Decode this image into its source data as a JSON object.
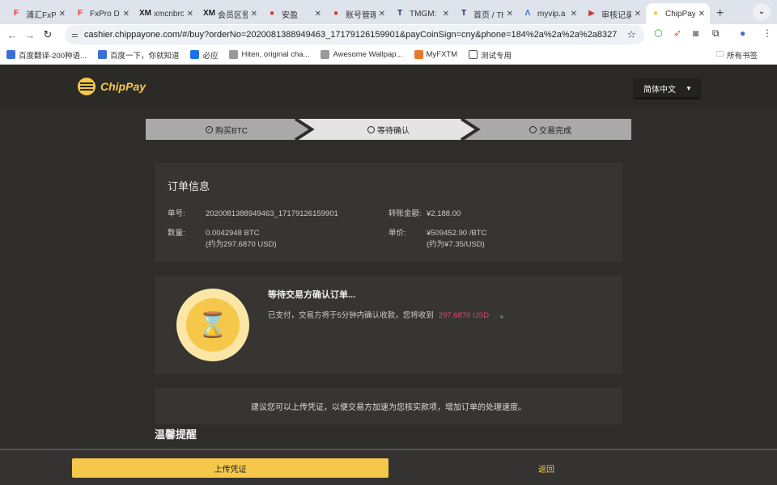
{
  "browser": {
    "tabs": [
      {
        "label": "浦汇FxPr",
        "fav": "F",
        "color": "#e03a3a"
      },
      {
        "label": "FxPro Di",
        "fav": "F",
        "color": "#e03a3a"
      },
      {
        "label": "xmcnbro",
        "fav": "XM",
        "color": "#222"
      },
      {
        "label": "会员区登",
        "fav": "XM",
        "color": "#222"
      },
      {
        "label": "安盈",
        "fav": "●",
        "color": "#d33"
      },
      {
        "label": "账号管理",
        "fav": "●",
        "color": "#d33"
      },
      {
        "label": "TMGM: I",
        "fav": "T",
        "color": "#1a2a5a"
      },
      {
        "label": "首页 / Th",
        "fav": "T",
        "color": "#1a2a5a"
      },
      {
        "label": "myvip.a",
        "fav": "Λ",
        "color": "#3a6fd8"
      },
      {
        "label": "审核记录",
        "fav": "▶",
        "color": "#c33"
      },
      {
        "label": "ChipPay",
        "fav": "●",
        "color": "#f5c84b"
      }
    ],
    "url": "cashier.chippayone.com/#/buy?orderNo=2020081388949463_17179126159901&payCoinSign=cny&phone=184%2a%2a%2a%2a8327",
    "bookmarks": [
      "百度翻译-200种语...",
      "百度一下，你就知道",
      "必应",
      "Hiten, original cha...",
      "Awesome Wallpap...",
      "MyFXTM",
      "测试专用"
    ],
    "all_bookmarks": "所有书签"
  },
  "header": {
    "brand": "ChipPay",
    "language": "简体中文"
  },
  "steps": [
    "购买BTC",
    "等待确认",
    "交易完成"
  ],
  "order": {
    "title": "订单信息",
    "order_no_label": "单号:",
    "order_no": "2020081388949463_17179126159901",
    "amount_label": "转账金额:",
    "amount": "¥2,188.00",
    "qty_label": "数量:",
    "qty": "0.0042948 BTC",
    "qty_usd": "(约为297.6870 USD)",
    "price_label": "单价:",
    "price": "¥509452.90 /BTC",
    "price_usd": "(约为¥7.35/USD)"
  },
  "waiting": {
    "title": "等待交易方确认订单...",
    "text": "已支付，交易方将于5分钟内确认收款，您将收到",
    "amount": "297.6870 USD",
    "end": "。",
    "amount_color": "#e0457b"
  },
  "suggestion": "建议您可以上传凭证，以便交易方加速为您核实款项，增加订单的处理速度。",
  "reminder_title": "温馨提醒",
  "footer": {
    "upload": "上传凭证",
    "back": "返回"
  }
}
